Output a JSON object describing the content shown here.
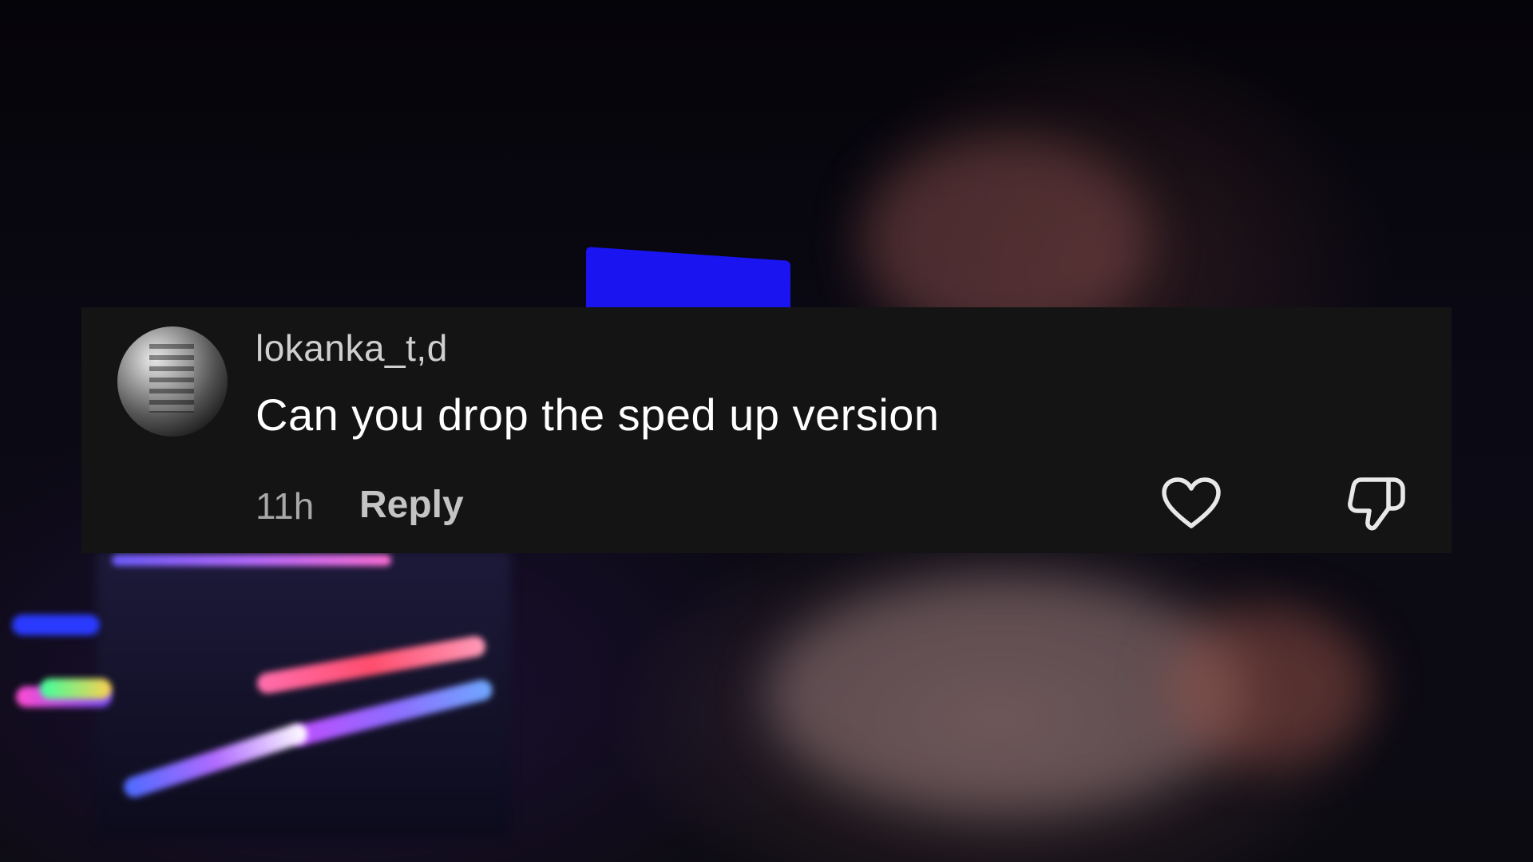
{
  "comment": {
    "username": "lokanka_t,d",
    "text": "Can you drop the sped up version",
    "timestamp": "11h",
    "reply_label": "Reply"
  },
  "icons": {
    "like": "heart-icon",
    "dislike": "thumbs-down-icon"
  },
  "colors": {
    "card_background": "#141414",
    "text_primary": "#ffffff",
    "text_secondary": "#a8a8a8"
  }
}
